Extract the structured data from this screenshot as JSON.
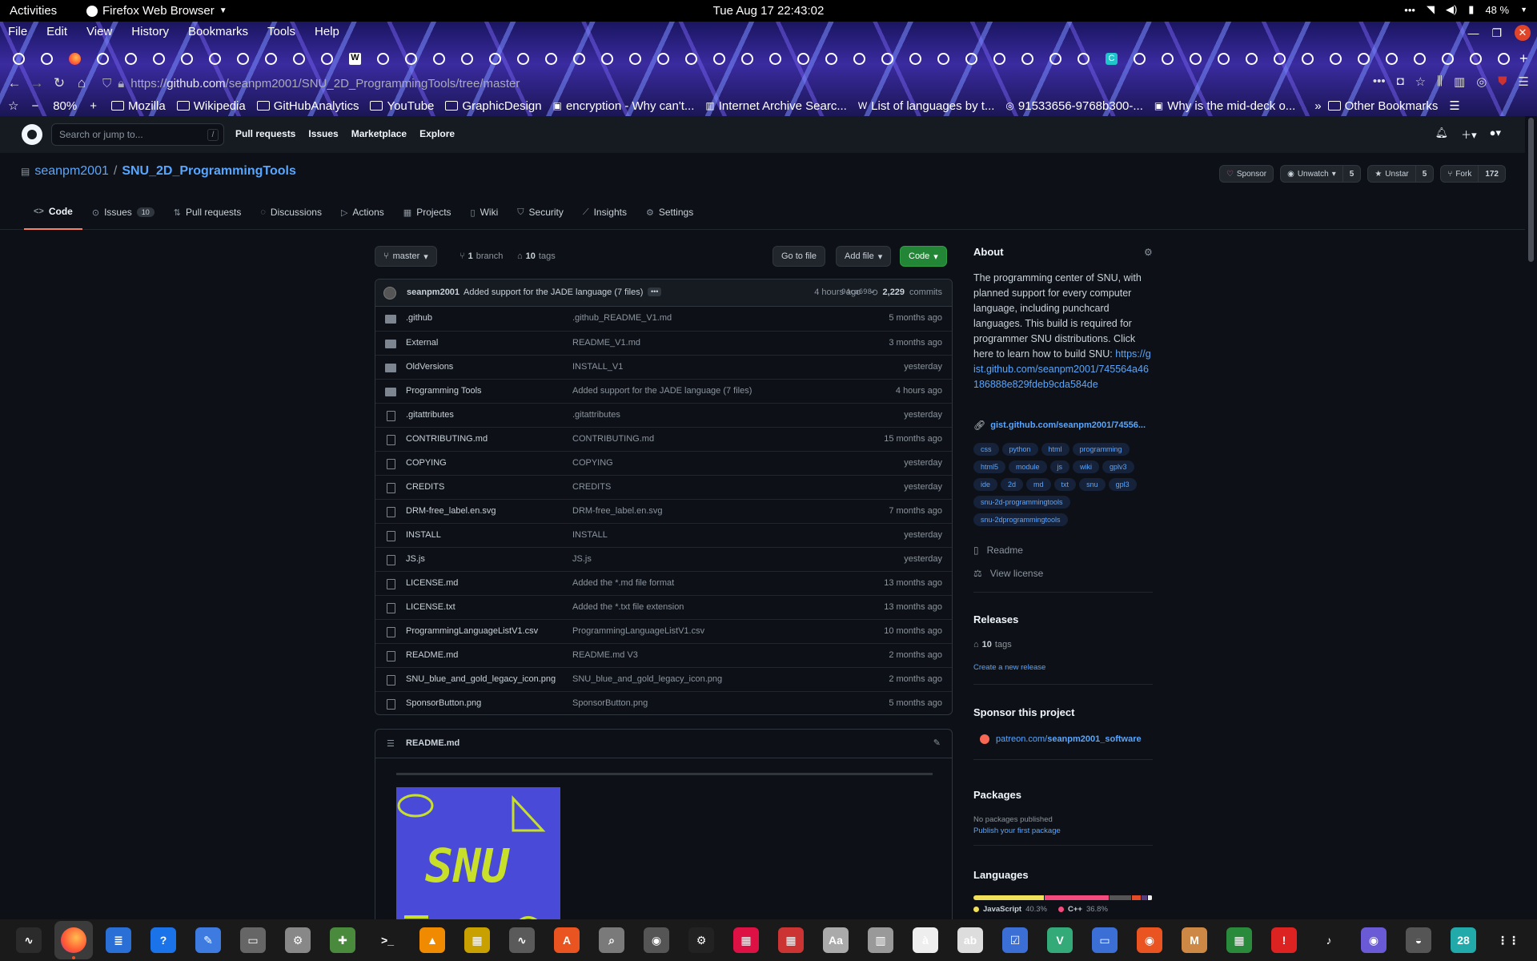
{
  "system": {
    "activities": "Activities",
    "app_name": "Firefox Web Browser",
    "clock": "Tue Aug 17  22:43:02",
    "battery": "48 %"
  },
  "browser": {
    "menu": [
      "File",
      "Edit",
      "View",
      "History",
      "Bookmarks",
      "Tools",
      "Help"
    ],
    "url_scheme": "https://",
    "url_host": "github.com",
    "url_path": "/seanpm2001/SNU_2D_ProgrammingTools/tree/master",
    "zoom": "80%",
    "bookmarks": [
      {
        "label": "Mozilla",
        "icon": "folder-icon"
      },
      {
        "label": "Wikipedia",
        "icon": "folder-icon"
      },
      {
        "label": "GitHubAnalytics",
        "icon": "folder-icon"
      },
      {
        "label": "YouTube",
        "icon": "folder-icon"
      },
      {
        "label": "GraphicDesign",
        "icon": "folder-icon"
      },
      {
        "label": "encryption - Why can't...",
        "icon": "stackexchange-icon"
      },
      {
        "label": "Internet Archive Searc...",
        "icon": "archive-icon"
      },
      {
        "label": "List of languages by t...",
        "icon": "wikipedia-icon"
      },
      {
        "label": "91533656-9768b300-...",
        "icon": "globe-icon"
      },
      {
        "label": "Why is the mid-deck o...",
        "icon": "stackexchange-icon"
      }
    ],
    "other_bookmarks": "Other Bookmarks"
  },
  "github": {
    "search_placeholder": "Search or jump to...",
    "search_key": "/",
    "nav": [
      "Pull requests",
      "Issues",
      "Marketplace",
      "Explore"
    ],
    "owner": "seanpm2001",
    "separator": "/",
    "repo": "SNU_2D_ProgrammingTools",
    "sponsor": "Sponsor",
    "unwatch": "Unwatch",
    "watch_count": "5",
    "unstar": "Unstar",
    "star_count": "5",
    "fork": "Fork",
    "fork_count": "172",
    "tabs": [
      {
        "label": "Code",
        "icon": "code-icon"
      },
      {
        "label": "Issues",
        "icon": "issue-icon",
        "count": "10"
      },
      {
        "label": "Pull requests",
        "icon": "pull-request-icon"
      },
      {
        "label": "Discussions",
        "icon": "discussion-icon"
      },
      {
        "label": "Actions",
        "icon": "play-icon"
      },
      {
        "label": "Projects",
        "icon": "project-icon"
      },
      {
        "label": "Wiki",
        "icon": "book-icon"
      },
      {
        "label": "Security",
        "icon": "shield-icon"
      },
      {
        "label": "Insights",
        "icon": "graph-icon"
      },
      {
        "label": "Settings",
        "icon": "gear-icon"
      }
    ],
    "branch": "master",
    "branches_count": "1",
    "branches_label": "branch",
    "tags_count": "10",
    "tags_label": "tags",
    "go_to_file": "Go to file",
    "add_file": "Add file",
    "code_btn": "Code",
    "commit": {
      "author": "seanpm2001",
      "message": "Added support for the JADE language (7 files)",
      "sha": "94ca698",
      "time": "4 hours ago",
      "count": "2,229",
      "count_label": "commits"
    },
    "files": [
      {
        "name": ".github",
        "type": "dir",
        "msg": ".github_README_V1.md",
        "age": "5 months ago"
      },
      {
        "name": "External",
        "type": "dir",
        "msg": "README_V1.md",
        "age": "3 months ago"
      },
      {
        "name": "OldVersions",
        "type": "dir",
        "msg": "INSTALL_V1",
        "age": "yesterday"
      },
      {
        "name": "Programming Tools",
        "type": "dir",
        "msg": "Added support for the JADE language (7 files)",
        "age": "4 hours ago"
      },
      {
        "name": ".gitattributes",
        "type": "file",
        "msg": ".gitattributes",
        "age": "yesterday"
      },
      {
        "name": "CONTRIBUTING.md",
        "type": "file",
        "msg": "CONTRIBUTING.md",
        "age": "15 months ago"
      },
      {
        "name": "COPYING",
        "type": "file",
        "msg": "COPYING",
        "age": "yesterday"
      },
      {
        "name": "CREDITS",
        "type": "file",
        "msg": "CREDITS",
        "age": "yesterday"
      },
      {
        "name": "DRM-free_label.en.svg",
        "type": "file",
        "msg": "DRM-free_label.en.svg",
        "age": "7 months ago"
      },
      {
        "name": "INSTALL",
        "type": "file",
        "msg": "INSTALL",
        "age": "yesterday"
      },
      {
        "name": "JS.js",
        "type": "file",
        "msg": "JS.js",
        "age": "yesterday"
      },
      {
        "name": "LICENSE.md",
        "type": "file",
        "msg": "Added the *.md file format",
        "age": "13 months ago"
      },
      {
        "name": "LICENSE.txt",
        "type": "file",
        "msg": "Added the *.txt file extension",
        "age": "13 months ago"
      },
      {
        "name": "ProgrammingLanguageListV1.csv",
        "type": "file",
        "msg": "ProgrammingLanguageListV1.csv",
        "age": "10 months ago"
      },
      {
        "name": "README.md",
        "type": "file",
        "msg": "README.md V3",
        "age": "2 months ago"
      },
      {
        "name": "SNU_blue_and_gold_legacy_icon.png",
        "type": "file",
        "msg": "SNU_blue_and_gold_legacy_icon.png",
        "age": "2 months ago"
      },
      {
        "name": "SponsorButton.png",
        "type": "file",
        "msg": "SponsorButton.png",
        "age": "5 months ago"
      }
    ],
    "readme_title": "README.md",
    "readme_logo_text": "SNU",
    "about": {
      "heading": "About",
      "description": "The programming center of SNU, with planned support for every computer language, including punchcard languages. This build is required for programmer SNU distributions. Click here to learn how to build SNU:",
      "desc_link": "https://gist.github.com/seanpm2001/745564a46186888e829fdeb9cda584de",
      "website": "gist.github.com/seanpm2001/74556...",
      "topics": [
        "css",
        "python",
        "html",
        "programming",
        "html5",
        "module",
        "js",
        "wiki",
        "gplv3",
        "ide",
        "2d",
        "md",
        "txt",
        "snu",
        "gpl3",
        "snu-2d-programmingtools",
        "snu-2dprogrammingtools"
      ],
      "readme": "Readme",
      "license": "View license"
    },
    "releases": {
      "heading": "Releases",
      "tags_count": "10",
      "tags_label": "tags",
      "create": "Create a new release"
    },
    "sponsor_section": {
      "heading": "Sponsor this project",
      "link_prefix": "patreon.com/",
      "link_name": "seanpm2001_software"
    },
    "packages": {
      "heading": "Packages",
      "none": "No packages published",
      "publish": "Publish your first package"
    },
    "languages": {
      "heading": "Languages",
      "items": [
        {
          "name": "JavaScript",
          "pct": "40.3%",
          "value": 40.3,
          "color": "#f1e05a"
        },
        {
          "name": "C++",
          "pct": "36.8%",
          "value": 36.8,
          "color": "#f34b7d"
        },
        {
          "name": "",
          "pct": "",
          "value": 12.5,
          "color": "#555555"
        },
        {
          "name": "",
          "pct": "",
          "value": 5.0,
          "color": "#e34c26"
        },
        {
          "name": "",
          "pct": "",
          "value": 3.0,
          "color": "#563d7c"
        },
        {
          "name": "",
          "pct": "",
          "value": 2.4,
          "color": "#ededed"
        }
      ]
    }
  },
  "taskbar": [
    "system-monitor-icon",
    "firefox-icon",
    "writer-icon",
    "help-icon",
    "text-editor-icon",
    "files-icon",
    "settings-icon",
    "games-icon",
    "terminal-icon",
    "vlc-icon",
    "calculator-icon",
    "plot-icon",
    "software-store-icon",
    "image-viewer-icon",
    "disk-icon",
    "inkscape-icon",
    "document-icon",
    "photo-icon",
    "font-icon",
    "archive-icon",
    "character-map-icon",
    "dictionary-icon",
    "tasks-icon",
    "vim-icon",
    "screen-icon",
    "ubuntu-icon",
    "mario-icon",
    "spreadsheet-icon",
    "alert-icon",
    "music-icon",
    "screenshot-icon",
    "mixer-icon",
    "calendar-icon",
    "apps-grid-icon"
  ]
}
